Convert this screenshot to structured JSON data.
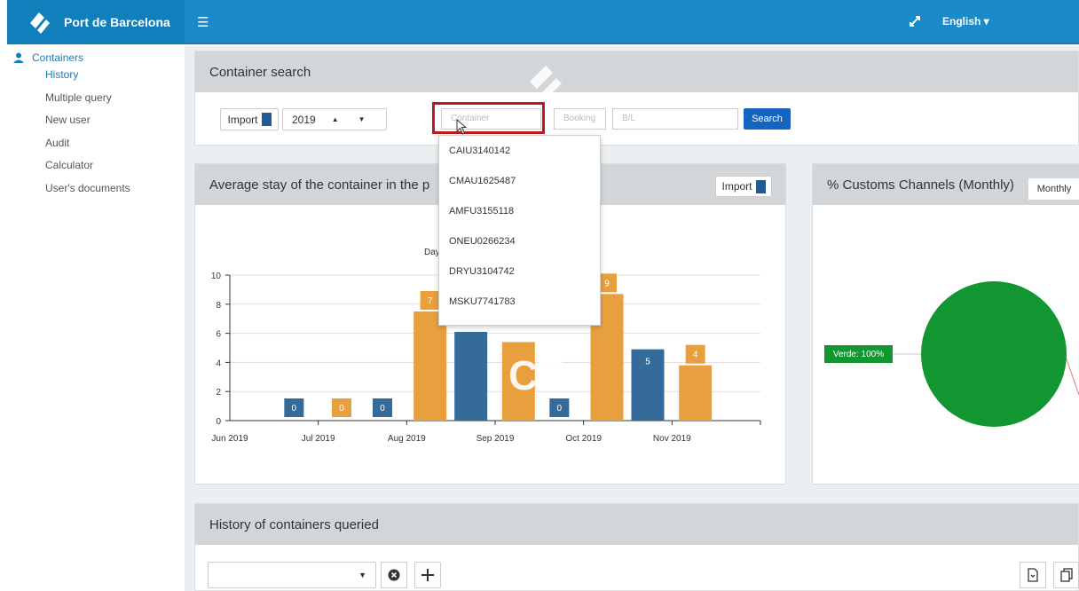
{
  "brand": {
    "name": "Port de Barcelona"
  },
  "header": {
    "language": "English"
  },
  "sidebar": {
    "section": "Containers",
    "items": [
      {
        "label": "History",
        "active": true
      },
      {
        "label": "Multiple query"
      },
      {
        "label": "New user"
      },
      {
        "label": "Audit"
      },
      {
        "label": "Calculator"
      },
      {
        "label": "User's documents"
      }
    ]
  },
  "search_panel": {
    "title": "Container search",
    "type_label": "Import",
    "year": "2019",
    "container_placeholder": "Container",
    "booking_placeholder": "Booking",
    "bl_placeholder": "B/L",
    "search_label": "Search"
  },
  "dropdown": {
    "options": [
      "CAIU3140142",
      "CMAU1625487",
      "AMFU3155118",
      "ONEU0266234",
      "DRYU3104742",
      "MSKU7741783"
    ]
  },
  "stay_panel": {
    "title": "Average stay of the container in the p",
    "type_label": "Import",
    "chart_subtitle_fragment": "Day"
  },
  "customs_panel": {
    "title": "% Customs Channels (Monthly)",
    "period": "Monthly",
    "slice_label": "Verde: 100%"
  },
  "history_panel": {
    "title": "History of containers queried"
  },
  "colors": {
    "import": "#e8a03f",
    "export": "#356b9a",
    "verde": "#129631",
    "brand": "#1a8ac8"
  },
  "chart_data": {
    "type": "bar",
    "categories": [
      "Jun 2019",
      "Jul 2019",
      "Aug 2019",
      "Sep 2019",
      "Oct 2019",
      "Nov 2019"
    ],
    "series": [
      {
        "values": [
          null,
          0,
          7.5,
          5.4,
          8.7,
          3.8
        ],
        "labels": [
          "",
          "0",
          "7",
          "",
          "9",
          "4"
        ]
      },
      {
        "values": [
          0,
          0,
          6.1,
          0,
          4.9,
          null
        ],
        "labels": [
          "0",
          "0",
          "",
          "0",
          "5",
          ""
        ]
      }
    ],
    "ylim": [
      0,
      10
    ],
    "yticks": [
      0,
      2,
      4,
      6,
      8,
      10
    ]
  }
}
